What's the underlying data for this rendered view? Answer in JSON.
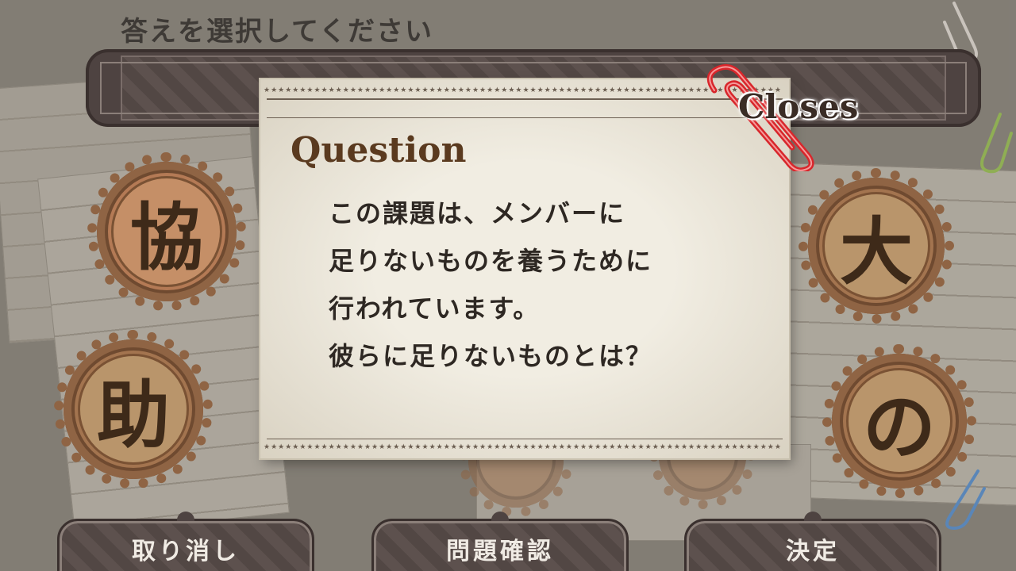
{
  "instruction": "答えを選択してください",
  "question_card": {
    "heading": "Question",
    "lines": [
      "この課題は、メンバーに",
      "足りないものを養うために",
      "行われています。",
      "彼らに足りないものとは？"
    ],
    "close_label": "Closes"
  },
  "choices": [
    "協",
    "助",
    "大",
    "の"
  ],
  "buttons": {
    "cancel": "取り消し",
    "confirm_question": "問題確認",
    "decide": "決定"
  },
  "colors": {
    "clip": "#d8262b",
    "button": "#554946",
    "gear": "#a3744f",
    "heading": "#5a3a1f"
  }
}
